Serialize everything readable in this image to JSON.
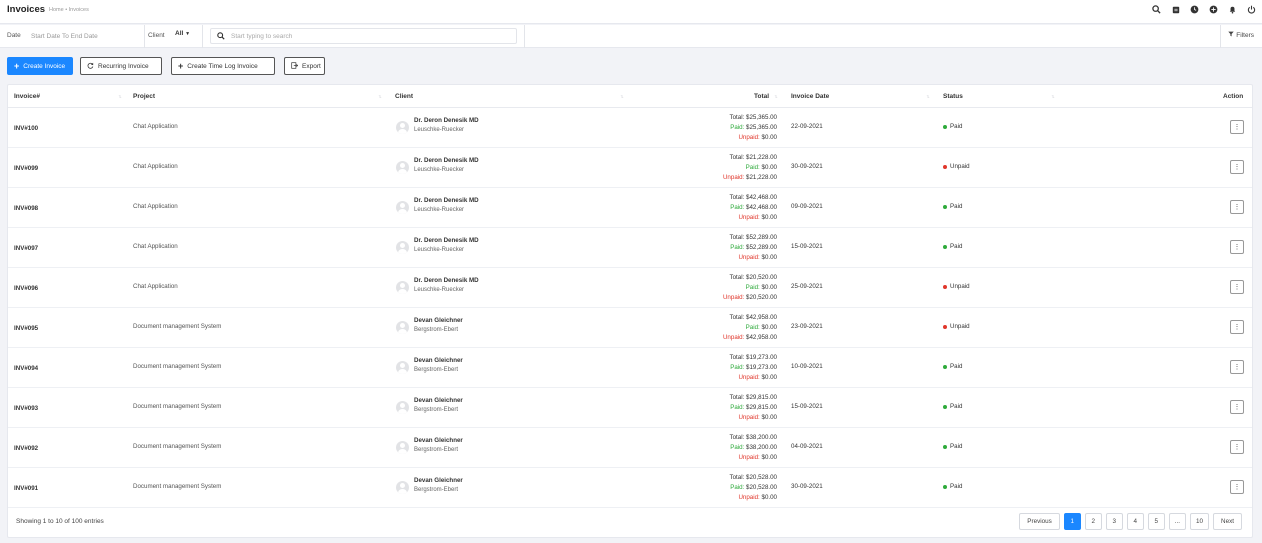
{
  "header": {
    "title": "Invoices",
    "breadcrumb": "Home • Invoices",
    "icons": [
      "search-icon",
      "notes-icon",
      "clock-icon",
      "plus-circle-icon",
      "bell-icon",
      "power-icon"
    ]
  },
  "filters": {
    "date_label": "Date",
    "date_placeholder": "Start Date To End Date",
    "client_label": "Client",
    "client_value": "All",
    "search_placeholder": "Start typing to search",
    "filters_label": "Filters"
  },
  "actions": {
    "create_invoice": "Create Invoice",
    "recurring_invoice": "Recurring Invoice",
    "create_time_log_invoice": "Create Time Log Invoice",
    "export": "Export"
  },
  "table": {
    "columns": {
      "invoice": "Invoice#",
      "project": "Project",
      "client": "Client",
      "total": "Total",
      "invoice_date": "Invoice Date",
      "status": "Status",
      "action": "Action"
    },
    "rows": [
      {
        "invoice": "INV#100",
        "project": "Chat Application",
        "client_name": "Dr. Deron Denesik MD",
        "client_company": "Leuschke-Ruecker",
        "total": "$25,365.00",
        "paid": "$25,365.00",
        "unpaid": "$0.00",
        "date": "22-09-2021",
        "status": "Paid"
      },
      {
        "invoice": "INV#099",
        "project": "Chat Application",
        "client_name": "Dr. Deron Denesik MD",
        "client_company": "Leuschke-Ruecker",
        "total": "$21,228.00",
        "paid": "$0.00",
        "unpaid": "$21,228.00",
        "date": "30-09-2021",
        "status": "Unpaid"
      },
      {
        "invoice": "INV#098",
        "project": "Chat Application",
        "client_name": "Dr. Deron Denesik MD",
        "client_company": "Leuschke-Ruecker",
        "total": "$42,468.00",
        "paid": "$42,468.00",
        "unpaid": "$0.00",
        "date": "09-09-2021",
        "status": "Paid"
      },
      {
        "invoice": "INV#097",
        "project": "Chat Application",
        "client_name": "Dr. Deron Denesik MD",
        "client_company": "Leuschke-Ruecker",
        "total": "$52,289.00",
        "paid": "$52,289.00",
        "unpaid": "$0.00",
        "date": "15-09-2021",
        "status": "Paid"
      },
      {
        "invoice": "INV#096",
        "project": "Chat Application",
        "client_name": "Dr. Deron Denesik MD",
        "client_company": "Leuschke-Ruecker",
        "total": "$20,520.00",
        "paid": "$0.00",
        "unpaid": "$20,520.00",
        "date": "25-09-2021",
        "status": "Unpaid"
      },
      {
        "invoice": "INV#095",
        "project": "Document management System",
        "client_name": "Devan Gleichner",
        "client_company": "Bergstrom-Ebert",
        "total": "$42,958.00",
        "paid": "$0.00",
        "unpaid": "$42,958.00",
        "date": "23-09-2021",
        "status": "Unpaid"
      },
      {
        "invoice": "INV#094",
        "project": "Document management System",
        "client_name": "Devan Gleichner",
        "client_company": "Bergstrom-Ebert",
        "total": "$19,273.00",
        "paid": "$19,273.00",
        "unpaid": "$0.00",
        "date": "10-09-2021",
        "status": "Paid"
      },
      {
        "invoice": "INV#093",
        "project": "Document management System",
        "client_name": "Devan Gleichner",
        "client_company": "Bergstrom-Ebert",
        "total": "$29,815.00",
        "paid": "$29,815.00",
        "unpaid": "$0.00",
        "date": "15-09-2021",
        "status": "Paid"
      },
      {
        "invoice": "INV#092",
        "project": "Document management System",
        "client_name": "Devan Gleichner",
        "client_company": "Bergstrom-Ebert",
        "total": "$38,200.00",
        "paid": "$38,200.00",
        "unpaid": "$0.00",
        "date": "04-09-2021",
        "status": "Paid"
      },
      {
        "invoice": "INV#091",
        "project": "Document management System",
        "client_name": "Devan Gleichner",
        "client_company": "Bergstrom-Ebert",
        "total": "$20,528.00",
        "paid": "$20,528.00",
        "unpaid": "$0.00",
        "date": "30-09-2021",
        "status": "Paid"
      }
    ],
    "total_label": "Total:",
    "paid_label": "Paid:",
    "unpaid_label": "Unpaid:"
  },
  "footer": {
    "info": "Showing 1 to 10 of 100 entries",
    "previous": "Previous",
    "next": "Next",
    "pages": [
      "1",
      "2",
      "3",
      "4",
      "5",
      "...",
      "10"
    ],
    "active_page": "1"
  },
  "colors": {
    "accent": "#1b87ff",
    "paid": "#2eaa3b",
    "unpaid": "#e0362b"
  }
}
